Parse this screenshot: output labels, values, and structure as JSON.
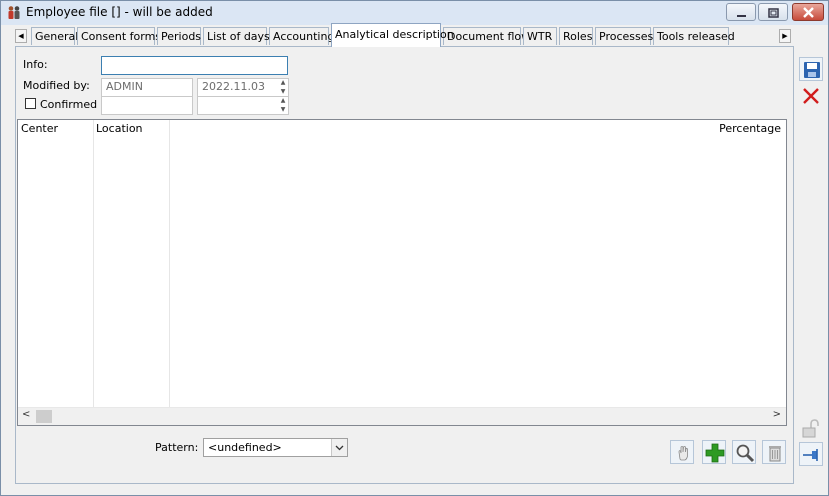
{
  "window": {
    "title": "Employee file [] - will be added"
  },
  "tabs": [
    {
      "label": "General"
    },
    {
      "label": "Consent forms"
    },
    {
      "label": "Periods"
    },
    {
      "label": "List of days"
    },
    {
      "label": "Accounting"
    },
    {
      "label": "Analytical description"
    },
    {
      "label": "Document flow"
    },
    {
      "label": "WTR"
    },
    {
      "label": "Roles"
    },
    {
      "label": "Processes"
    },
    {
      "label": "Tools released"
    }
  ],
  "form": {
    "info_label": "Info:",
    "info_value": "",
    "modified_by_label": "Modified by:",
    "modified_by_value": "ADMIN",
    "modified_date": "2022.11.03",
    "confirmed_by_label": "Confirmed by",
    "confirmed_by_value": "",
    "confirmed_date": "",
    "confirmed_checked": false
  },
  "grid": {
    "columns": [
      "Center",
      "Location",
      "Percentage"
    ],
    "rows": []
  },
  "pattern": {
    "label": "Pattern:",
    "value": "<undefined>"
  },
  "icons": {
    "app": "employee-icon",
    "save": "save-icon",
    "cancel": "cancel-icon",
    "lock": "lock-icon",
    "pin": "pin-icon",
    "hand": "hand-icon",
    "add": "add-icon",
    "search": "magnifier-icon",
    "delete": "trash-icon"
  },
  "colors": {
    "title_bar": "#dbe6f4",
    "close_button": "#c74b3b",
    "add_green": "#2e9a22",
    "cancel_red": "#d11c1c",
    "save_blue": "#2c64b0"
  }
}
